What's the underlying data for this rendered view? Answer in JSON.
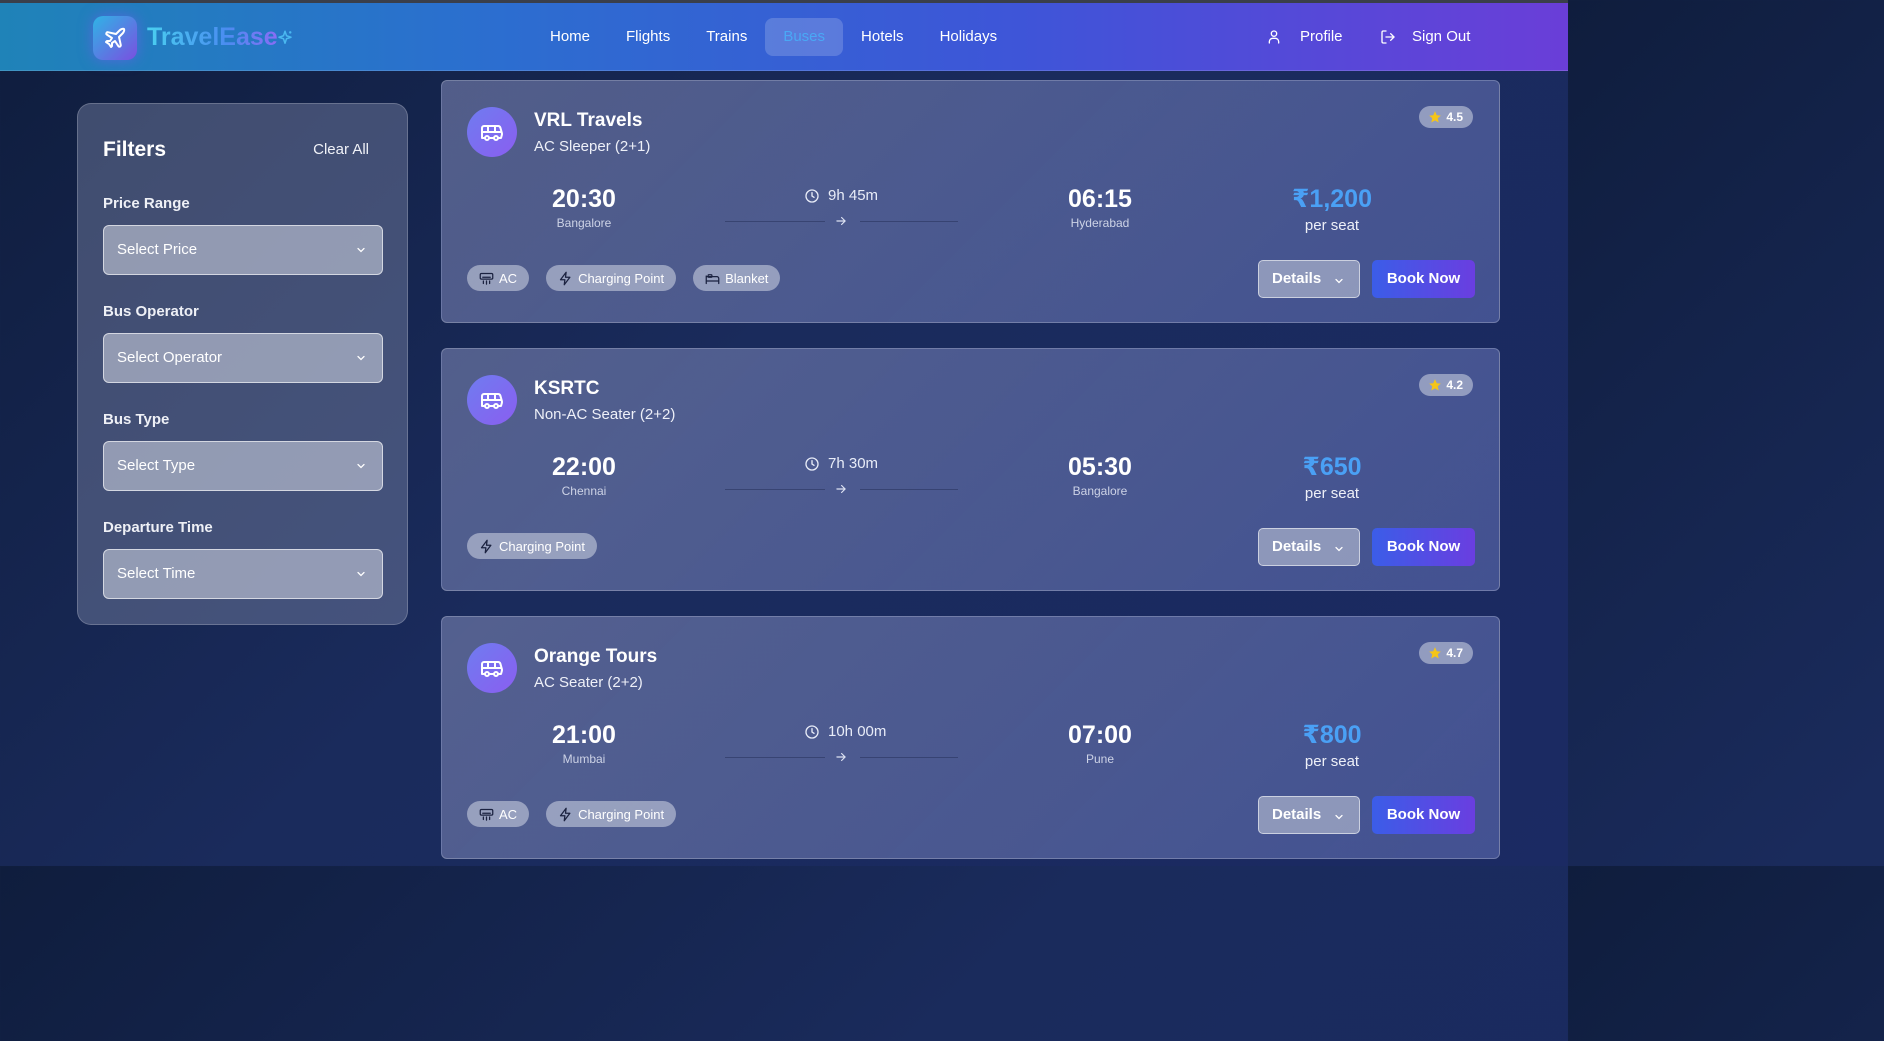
{
  "app": {
    "name": "TravelEase"
  },
  "nav": {
    "items": [
      "Home",
      "Flights",
      "Trains",
      "Buses",
      "Hotels",
      "Holidays"
    ],
    "active": "Buses",
    "profile": "Profile",
    "sign_out": "Sign Out"
  },
  "filters": {
    "title": "Filters",
    "clear_all": "Clear All",
    "price_label": "Price Range",
    "price_value": "Select Price",
    "operator_label": "Bus Operator",
    "operator_value": "Select Operator",
    "type_label": "Bus Type",
    "type_value": "Select Type",
    "time_label": "Departure Time",
    "time_value": "Select Time"
  },
  "buses": [
    {
      "operator": "VRL Travels",
      "bus_type": "AC Sleeper (2+1)",
      "rating": "4.5",
      "departure": "20:30",
      "from": "Bangalore",
      "duration": "9h 45m",
      "arrival": "06:15",
      "to": "Hyderabad",
      "price": "₹1,200",
      "price_unit": "per seat",
      "amenities": [
        {
          "label": "AC",
          "icon": "ac-icon"
        },
        {
          "label": "Charging Point",
          "icon": "bolt-icon"
        },
        {
          "label": "Blanket",
          "icon": "bed-icon"
        }
      ],
      "details_label": "Details",
      "book_label": "Book Now"
    },
    {
      "operator": "KSRTC",
      "bus_type": "Non-AC Seater (2+2)",
      "rating": "4.2",
      "departure": "22:00",
      "from": "Chennai",
      "duration": "7h 30m",
      "arrival": "05:30",
      "to": "Bangalore",
      "price": "₹650",
      "price_unit": "per seat",
      "amenities": [
        {
          "label": "Charging Point",
          "icon": "bolt-icon"
        }
      ],
      "details_label": "Details",
      "book_label": "Book Now"
    },
    {
      "operator": "Orange Tours",
      "bus_type": "AC Seater (2+2)",
      "rating": "4.7",
      "departure": "21:00",
      "from": "Mumbai",
      "duration": "10h 00m",
      "arrival": "07:00",
      "to": "Pune",
      "price": "₹800",
      "price_unit": "per seat",
      "amenities": [
        {
          "label": "AC",
          "icon": "ac-icon"
        },
        {
          "label": "Charging Point",
          "icon": "bolt-icon"
        }
      ],
      "details_label": "Details",
      "book_label": "Book Now"
    }
  ],
  "colors": {
    "accent": "#4aa0f5",
    "book_gradient_start": "#3b5de8",
    "book_gradient_end": "#6a3ee0",
    "star": "#f5c518"
  }
}
